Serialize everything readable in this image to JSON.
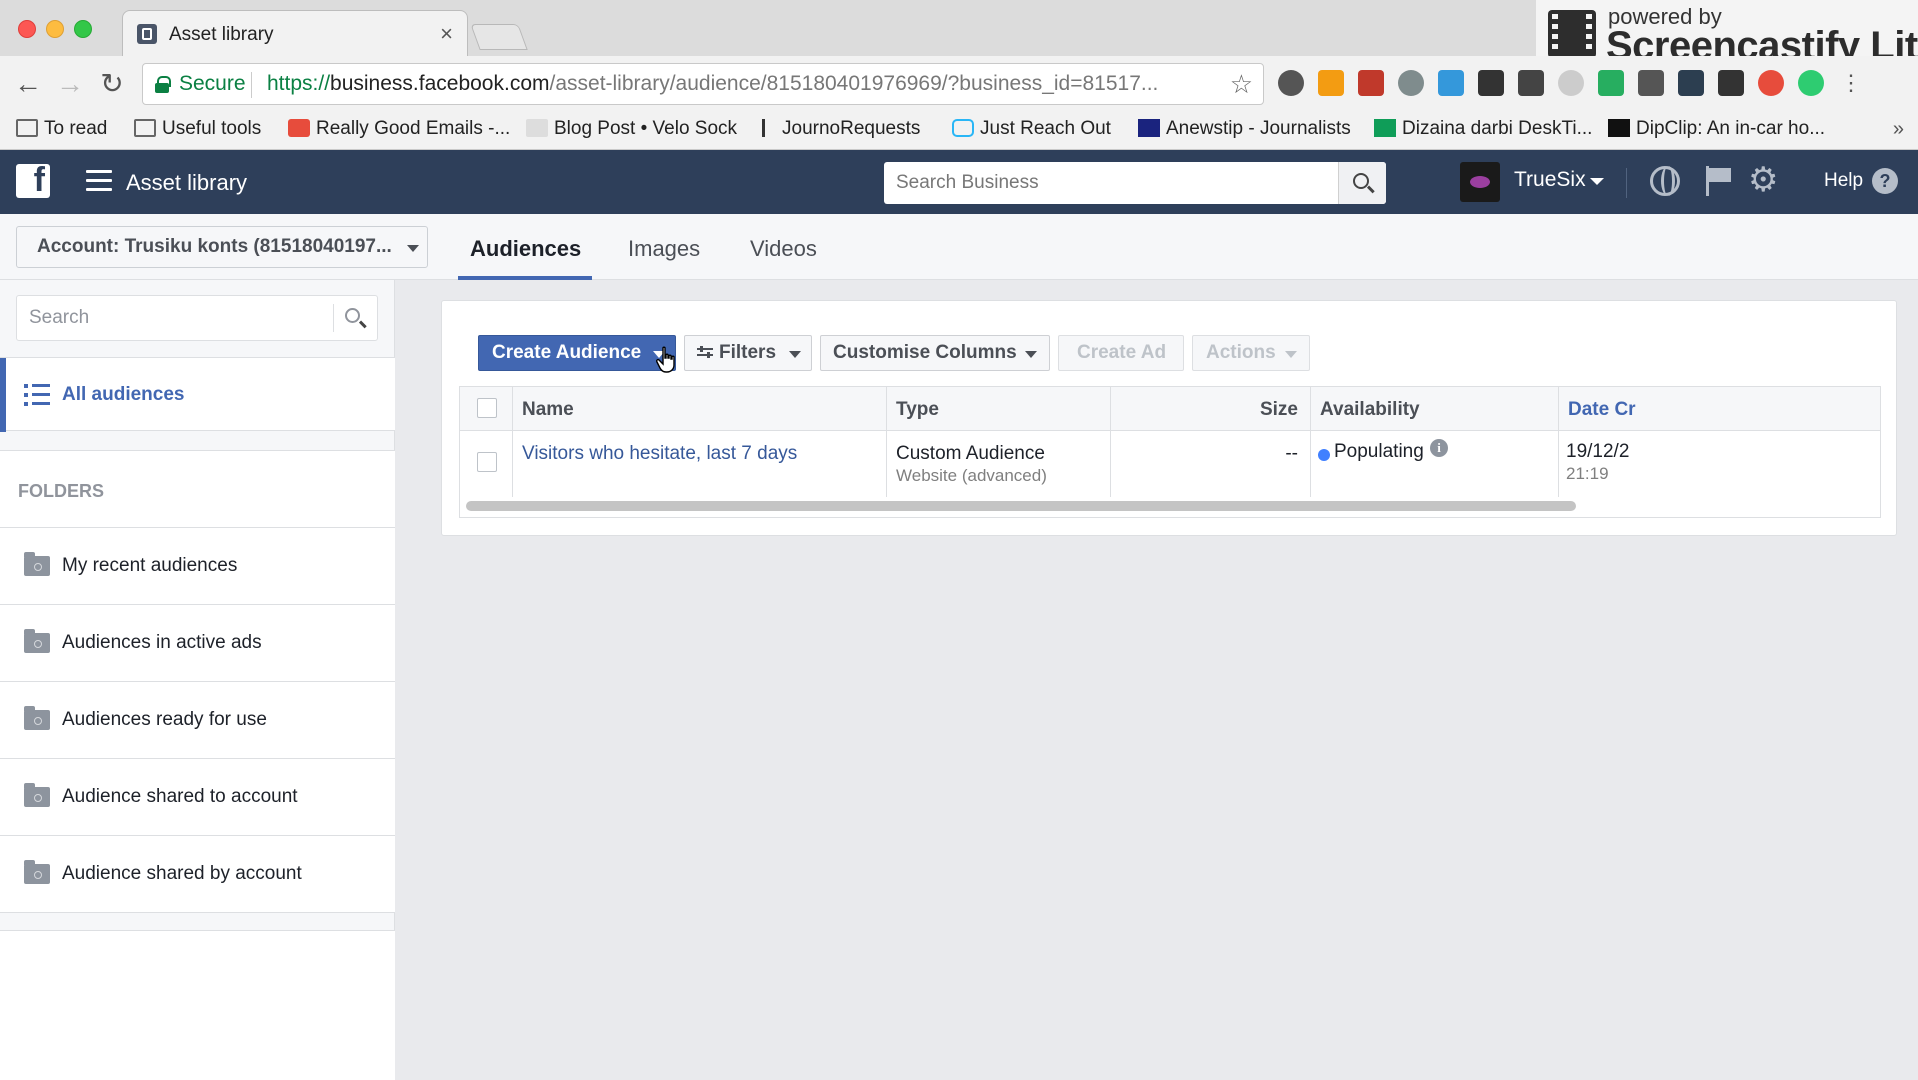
{
  "browser": {
    "tab_title": "Asset library",
    "secure_label": "Secure",
    "url_scheme": "https://",
    "url_host": "business.facebook.com",
    "url_path": "/asset-library/audience/815180401976969/?business_id=81517...",
    "bookmarks": [
      {
        "label": "To read",
        "icon": "folder-icon"
      },
      {
        "label": "Useful tools",
        "icon": "folder-icon"
      },
      {
        "label": "Really Good Emails -...",
        "icon": "email-icon"
      },
      {
        "label": "Blog Post • Velo Sock",
        "icon": "sock-icon"
      },
      {
        "label": "JournoRequests",
        "icon": "request-icon"
      },
      {
        "label": "Just Reach Out",
        "icon": "chat-icon"
      },
      {
        "label": "Anewstip - Journalists",
        "icon": "news-icon"
      },
      {
        "label": "Dizaina darbi DeskTi...",
        "icon": "sheet-icon"
      },
      {
        "label": "DipClip: An in-car ho...",
        "icon": "dipclip-icon"
      }
    ],
    "overlay": {
      "powered_by": "powered by",
      "brand": "Screencastify Lite"
    }
  },
  "header": {
    "title": "Asset library",
    "search_placeholder": "Search Business",
    "business_name": "TrueSix",
    "help_label": "Help"
  },
  "subbar": {
    "account_label": "Account: Trusiku konts (81518040197...",
    "tabs": [
      {
        "label": "Audiences",
        "active": true
      },
      {
        "label": "Images",
        "active": false
      },
      {
        "label": "Videos",
        "active": false
      }
    ]
  },
  "sidebar": {
    "search_placeholder": "Search",
    "all_audiences_label": "All audiences",
    "folders_heading": "FOLDERS",
    "folders": [
      "My recent audiences",
      "Audiences in active ads",
      "Audiences ready for use",
      "Audience shared to account",
      "Audience shared by account"
    ]
  },
  "toolbar": {
    "create_audience": "Create Audience",
    "filters": "Filters",
    "customise_columns": "Customise Columns",
    "create_ad": "Create Ad",
    "actions": "Actions"
  },
  "table": {
    "columns": [
      "Name",
      "Type",
      "Size",
      "Availability",
      "Date Cr"
    ],
    "rows": [
      {
        "name": "Visitors who hesitate, last 7 days",
        "type": "Custom Audience",
        "subtype": "Website (advanced)",
        "size": "--",
        "availability": "Populating",
        "date": "19/12/2(",
        "time": "21:19"
      }
    ]
  },
  "colors": {
    "header_bg": "#2e3f5a",
    "accent": "#4267b2",
    "link": "#365899",
    "status_dot": "#4080ff"
  }
}
